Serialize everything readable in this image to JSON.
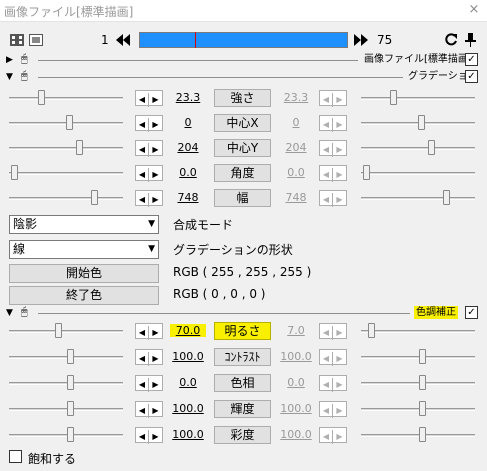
{
  "window": {
    "title": "画像ファイル[標準描画]",
    "close_glyph": "×"
  },
  "toolbar": {
    "frame_start": "1",
    "frame_end": "75"
  },
  "sections": {
    "image_file": {
      "label": "画像ファイル[標準描画]"
    },
    "gradient": {
      "label": "グラデーション"
    },
    "color_correction": {
      "label": "色調補正"
    }
  },
  "gradient_params": [
    {
      "label": "強さ",
      "value": "23.3",
      "end_value": "23.3"
    },
    {
      "label": "中心X",
      "value": "0",
      "end_value": "0"
    },
    {
      "label": "中心Y",
      "value": "204",
      "end_value": "204"
    },
    {
      "label": "角度",
      "value": "0.0",
      "end_value": "0.0"
    },
    {
      "label": "幅",
      "value": "748",
      "end_value": "748"
    }
  ],
  "blend": {
    "selected": "陰影",
    "label": "合成モード"
  },
  "shape": {
    "selected": "線",
    "label": "グラデーションの形状"
  },
  "start_color": {
    "button": "開始色",
    "value": "RGB ( 255 , 255 , 255 )"
  },
  "end_color": {
    "button": "終了色",
    "value": "RGB ( 0 , 0 , 0 )"
  },
  "color_params": [
    {
      "label": "明るさ",
      "value": "70.0",
      "end_value": "7.0"
    },
    {
      "label": "ｺﾝﾄﾗｽﾄ",
      "value": "100.0",
      "end_value": "100.0"
    },
    {
      "label": "色相",
      "value": "0.0",
      "end_value": "0.0"
    },
    {
      "label": "輝度",
      "value": "100.0",
      "end_value": "100.0"
    },
    {
      "label": "彩度",
      "value": "100.0",
      "end_value": "100.0"
    }
  ],
  "saturate_option": {
    "label": "飽和する"
  },
  "colors": {
    "timeline": "#1e90ff",
    "highlight": "#f8f000"
  }
}
